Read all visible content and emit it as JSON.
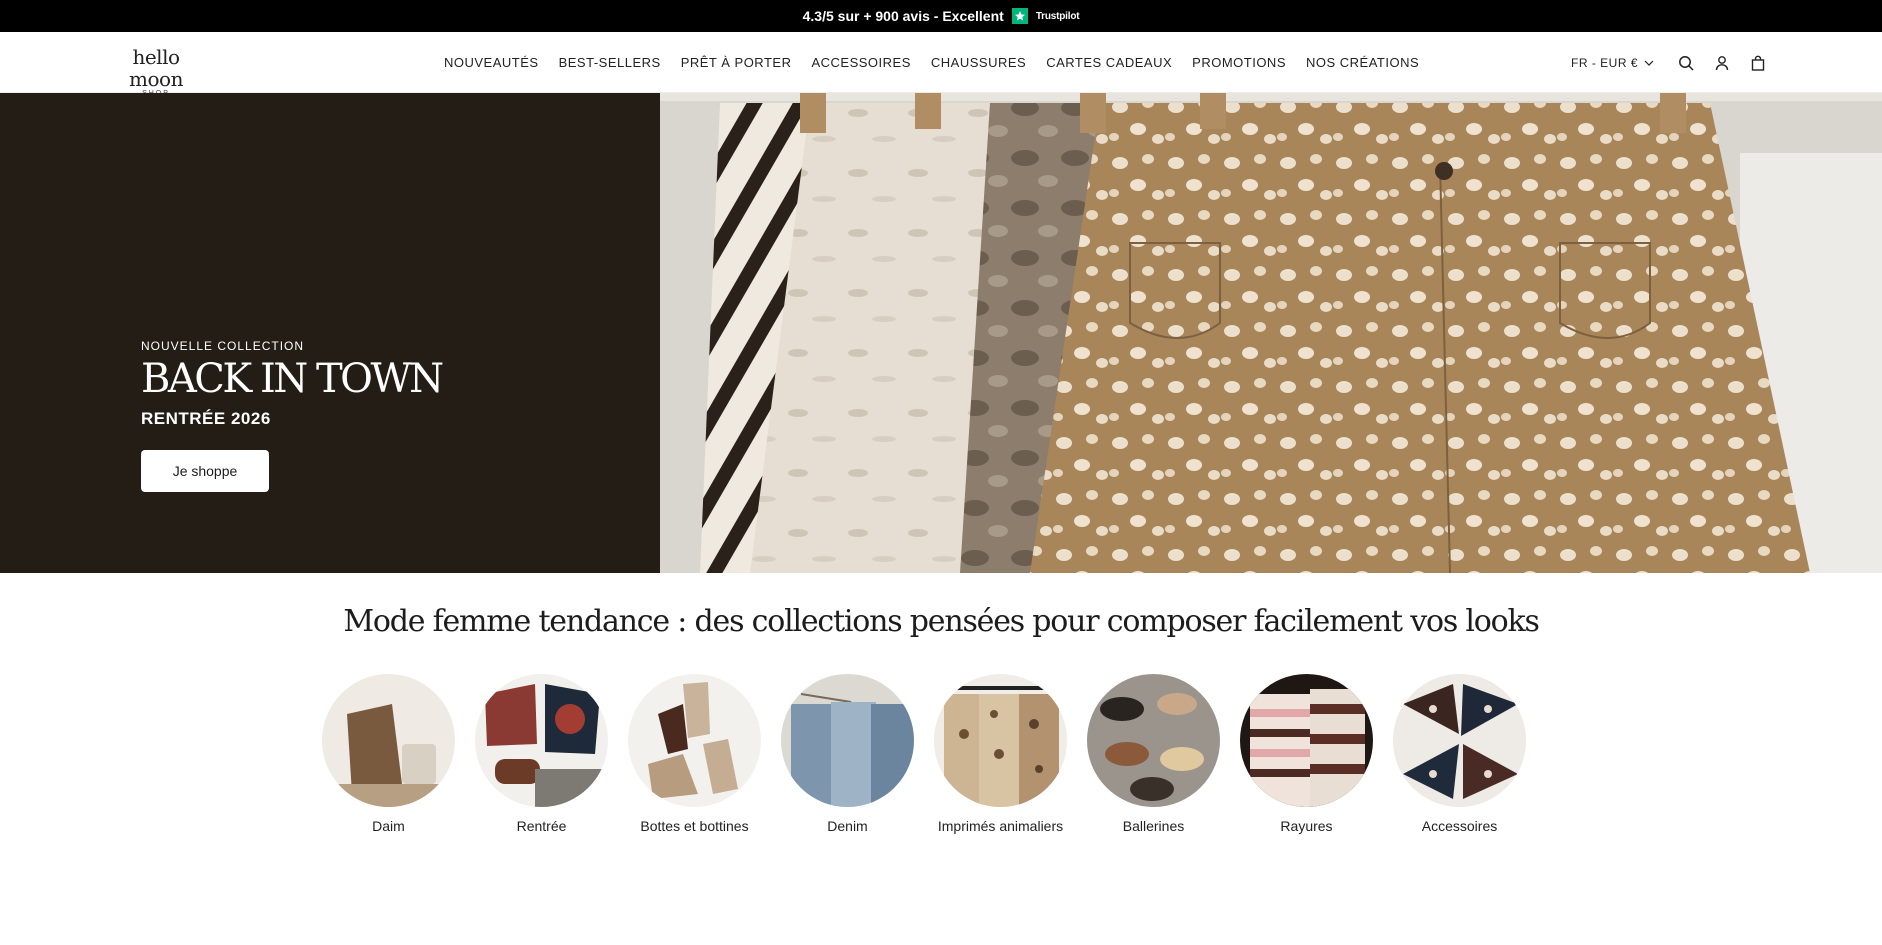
{
  "announcement": {
    "text": "4.3/5 sur + 900 avis - Excellent",
    "trustpilot": "Trustpilot"
  },
  "logo": {
    "main": "hello moon",
    "sub": "SHOP"
  },
  "nav": {
    "items": [
      "NOUVEAUTÉS",
      "BEST-SELLERS",
      "PRÊT À PORTER",
      "ACCESSOIRES",
      "CHAUSSURES",
      "CARTES CADEAUX",
      "PROMOTIONS",
      "NOS CRÉATIONS"
    ]
  },
  "header": {
    "locale": "FR - EUR €"
  },
  "icons": {
    "search": "search-icon",
    "account": "user-icon",
    "cart": "shopping-bag-icon",
    "chevron": "chevron-down-icon"
  },
  "hero": {
    "eyebrow": "NOUVELLE COLLECTION",
    "title": "BACK IN TOWN",
    "subtitle": "RENTRÉE 2026",
    "cta": "Je shoppe"
  },
  "section": {
    "title": "Mode femme tendance : des collections pensées pour composer facilement vos looks",
    "categories": [
      "Daim",
      "Rentrée",
      "Bottes et bottines",
      "Denim",
      "Imprimés animaliers",
      "Ballerines",
      "Rayures",
      "Accessoires"
    ]
  },
  "colors": {
    "hero_panel": "#241d15",
    "topbar": "#000000",
    "trustpilot": "#00b67a"
  }
}
